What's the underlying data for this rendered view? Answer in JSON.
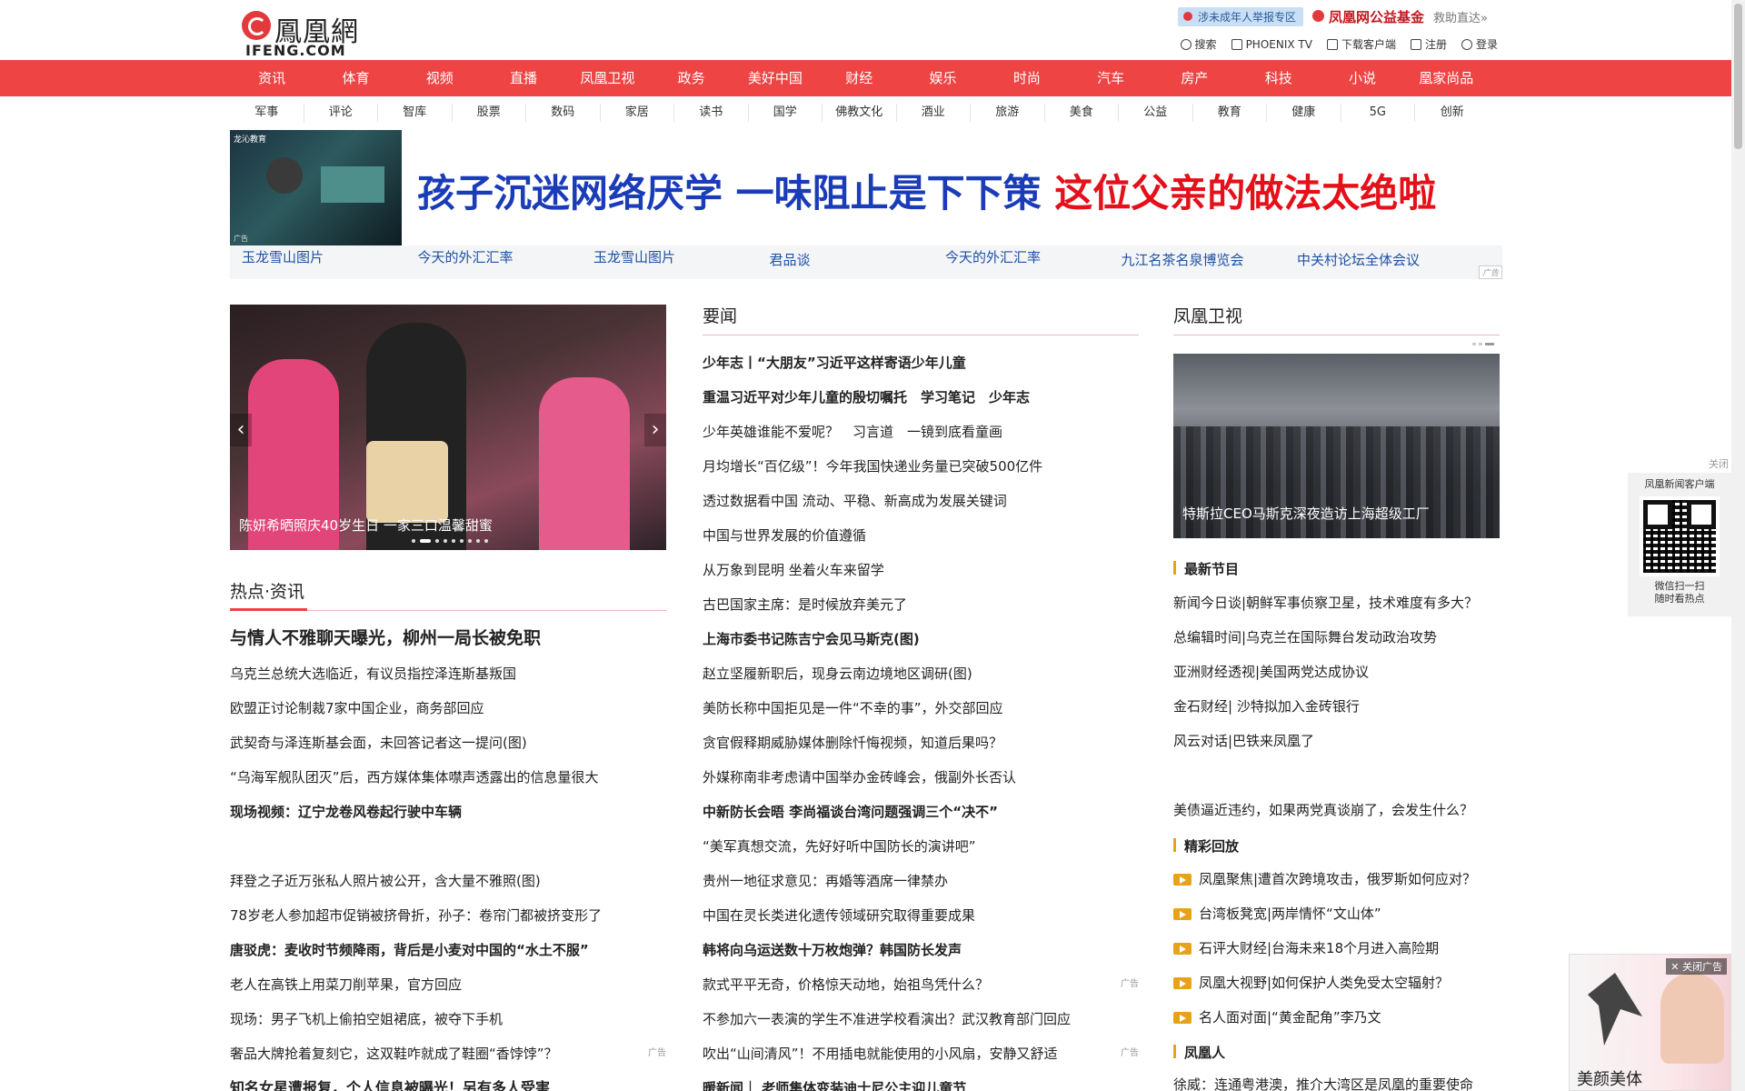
{
  "logo": {
    "cn": "鳳凰網",
    "en": "IFENG.COM"
  },
  "top_promo": {
    "report": "涉未成年人举报专区",
    "charity": "凤凰网公益基金",
    "rescue": "救助直达»"
  },
  "top_links": [
    "搜索",
    "PHOENIX TV",
    "下载客户端",
    "注册",
    "登录"
  ],
  "main_nav": [
    "资讯",
    "体育",
    "视频",
    "直播",
    "凤凰卫视",
    "政务",
    "美好中国",
    "财经",
    "娱乐",
    "时尚",
    "汽车",
    "房产",
    "科技",
    "小说",
    "凰家尚品"
  ],
  "sub_nav": [
    "军事",
    "评论",
    "智库",
    "股票",
    "数码",
    "家居",
    "读书",
    "国学",
    "佛教文化",
    "酒业",
    "旅游",
    "美食",
    "公益",
    "教育",
    "健康",
    "5G",
    "创新"
  ],
  "banner": {
    "tag": "龙沁教育",
    "ad": "广告",
    "headline_blue": "孩子沉迷网络厌学 一味阻止是下下策",
    "headline_red": "这位父亲的做法太绝啦"
  },
  "ad_links": {
    "items": [
      "玉龙雪山图片",
      "今天的外汇汇率",
      "玉龙雪山图片",
      "君品谈",
      "今天的外汇汇率",
      "九江名茶名泉博览会",
      "中关村论坛全体会议"
    ],
    "tag": "广告"
  },
  "carousel": {
    "caption": "陈妍希晒照庆40岁生日 一家三口温馨甜蜜",
    "prev": "‹",
    "next": "›"
  },
  "hot": {
    "title": "热点·资讯",
    "items": [
      "与情人不雅聊天曝光，柳州一局长被免职",
      "乌克兰总统大选临近，有议员指控泽连斯基叛国",
      "欧盟正讨论制裁7家中国企业，商务部回应",
      "武契奇与泽连斯基会面，未回答记者这一提问(图)",
      "“乌海军舰队团灭”后，西方媒体集体噤声透露出的信息量很大",
      "现场视频：辽宁龙卷风卷起行驶中车辆",
      "",
      "拜登之子近万张私人照片被公开，含大量不雅照(图)",
      "78岁老人参加超市促销被挤骨折，孙子：卷帘门都被挤变形了",
      "唐驳虎：麦收时节频降雨，背后是小麦对中国的“水土不服”",
      "老人在高铁上用菜刀削苹果，官方回应",
      "现场：男子飞机上偷拍空姐裙底，被夺下手机",
      "奢品大牌抢着复刻它，这双鞋咋就成了鞋圈“香饽饽”？",
      "知名女星遭报复，个人信息被曝光！另有多人受害"
    ],
    "ad": "广告"
  },
  "news": {
    "title": "要闻",
    "items": [
      "少年志丨“大朋友”习近平这样寄语少年儿童",
      "重温习近平对少年儿童的殷切嘱托　学习笔记　少年志",
      "少年英雄谁能不爱呢？　习言道　一镜到底看童画",
      "月均增长“百亿级”！今年我国快递业务量已突破500亿件",
      "透过数据看中国 流动、平稳、新高成为发展关键词",
      "中国与世界发展的价值遵循",
      "从万象到昆明 坐着火车来留学",
      "古巴国家主席：是时候放弃美元了",
      "上海市委书记陈吉宁会见马斯克(图)",
      "赵立坚履新职后，现身云南边境地区调研(图)",
      "美防长称中国拒见是一件“不幸的事”，外交部回应",
      "贪官假释期威胁媒体删除忏悔视频，知道后果吗？",
      "外媒称南非考虑请中国举办金砖峰会，俄副外长否认",
      "中新防长会晤 李尚福谈台湾问题强调三个“决不”",
      "“美军真想交流，先好好听中国防长的演讲吧”",
      "贵州一地征求意见：再婚等酒席一律禁办",
      "中国在灵长类进化遗传领域研究取得重要成果",
      "韩将向乌运送数十万枚炮弹？韩国防长发声",
      "款式平平无奇，价格惊天动地，始祖鸟凭什么？",
      "不参加六一表演的学生不准进学校看演出？武汉教育部门回应",
      "吹出“山间清风”！不用插电就能使用的小风扇，安静又舒适",
      "暖新闻｜ 老师集体变装迪士尼公主迎儿童节"
    ],
    "ad": "广告"
  },
  "tv": {
    "title": "凤凰卫视",
    "caption": "特斯拉CEO马斯克深夜造访上海超级工厂",
    "latest_title": "最新节目",
    "latest": [
      "新闻今日谈|朝鲜军事侦察卫星，技术难度有多大？",
      "总编辑时间|乌克兰在国际舞台发动政治攻势",
      "亚洲财经透视|美国两党达成协议",
      "金石财经| 沙特拟加入金砖银行",
      "风云对话|巴铁来凤凰了",
      "",
      "美债逼近违约，如果两党真谈崩了，会发生什么？"
    ],
    "replay_title": "精彩回放",
    "replay": [
      "凤凰聚焦|遭首次跨境攻击，俄罗斯如何应对？",
      "台湾板凳宽|两岸情怀“文山体”",
      "石评大财经|台海未来18个月进入高险期",
      "凤凰大视野|如何保护人类免受太空辐射？",
      "名人面对面|“黄金配角”李乃文"
    ],
    "people_title": "凤凰人",
    "people": [
      "徐威：连通粤港澳，推介大湾区是凤凰的重要使命"
    ]
  },
  "qr": {
    "close": "关闭",
    "title": "凤凰新闻客户端",
    "line1": "微信扫一扫",
    "line2": "随时看热点"
  },
  "float_ad": {
    "close": "✕ 关闭广告",
    "text": "美颜美体"
  }
}
